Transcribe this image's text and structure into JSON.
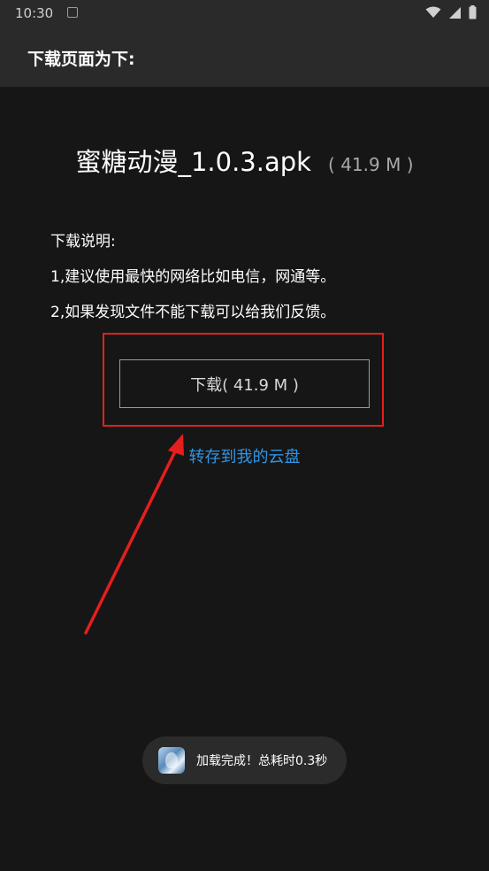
{
  "status_bar": {
    "time": "10:30"
  },
  "app_bar": {
    "title": "下载页面为下:"
  },
  "file": {
    "name": "蜜糖动漫_1.0.3.apk",
    "size": "( 41.9 M )"
  },
  "instructions": {
    "heading": "下载说明:",
    "items": [
      "1,建议使用最快的网络比如电信，网通等。",
      "2,如果发现文件不能下载可以给我们反馈。"
    ]
  },
  "download_button": {
    "label": "下载( 41.9 M )"
  },
  "cloud_link": {
    "label": "转存到我的云盘"
  },
  "toast": {
    "message": "加载完成！总耗时0.3秒"
  },
  "colors": {
    "background": "#161616",
    "bar": "#2a2a2a",
    "link": "#2f95e6",
    "highlight": "#e51e1e"
  }
}
